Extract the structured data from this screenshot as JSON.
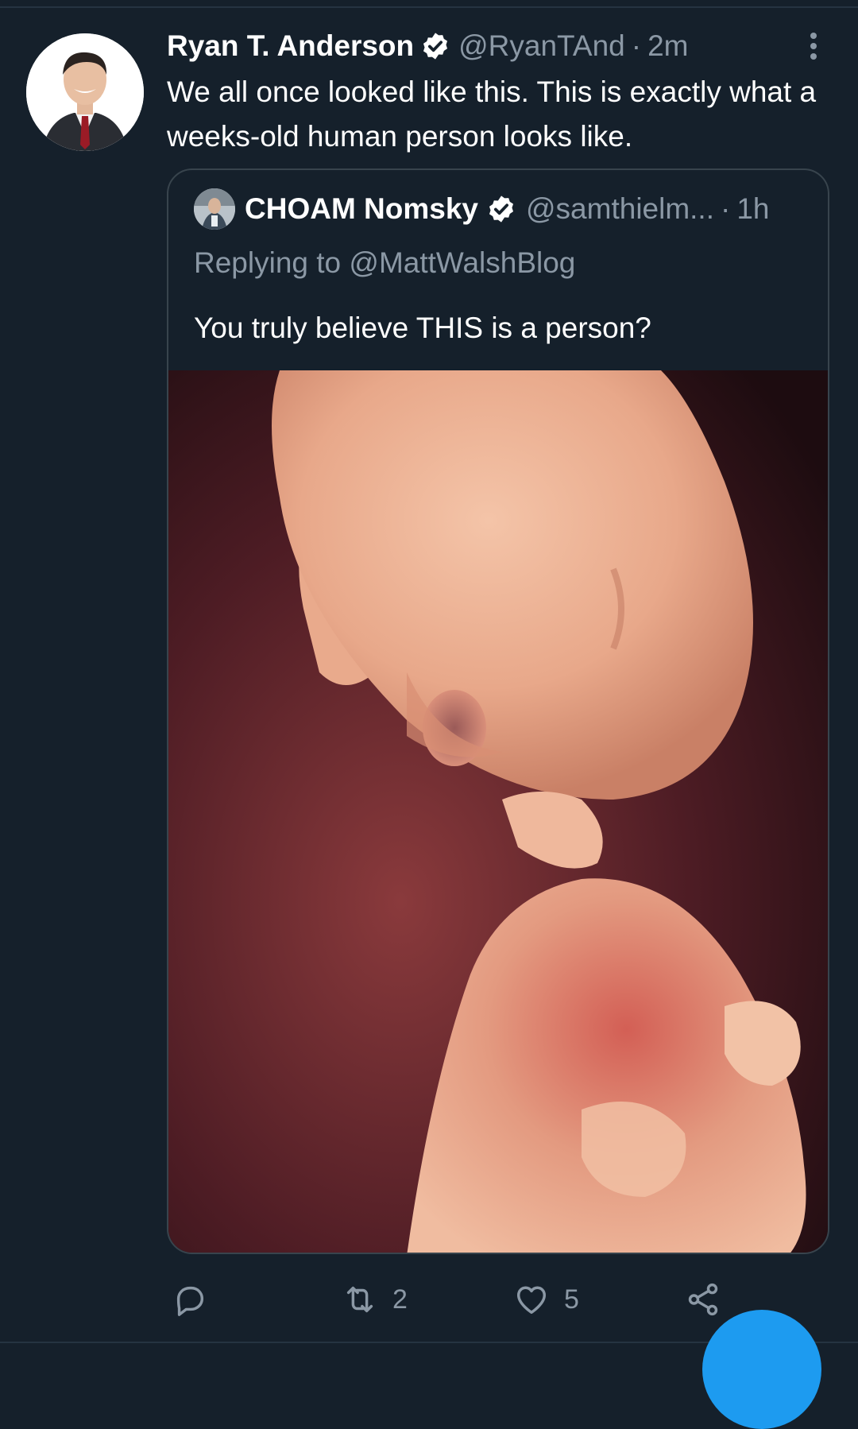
{
  "tweet": {
    "author": {
      "display_name": "Ryan T. Anderson",
      "handle": "@RyanTAnd",
      "verified": true,
      "avatar": "man-in-suit-red-tie"
    },
    "separator": "·",
    "time": "2m",
    "text": "We all once looked like this. This is exactly what a weeks-old human person looks like.",
    "more_icon": "more-vertical-icon"
  },
  "quoted_tweet": {
    "author": {
      "display_name": "CHOAM Nomsky",
      "handle": "@samthielm...",
      "verified": true
    },
    "separator": "·",
    "time": "1h",
    "replying_to": "Replying to @MattWalshBlog",
    "text": "You truly believe THIS is a person?",
    "media": "photo-embryo"
  },
  "actions": {
    "reply": {
      "icon": "reply-icon",
      "count": ""
    },
    "retweet": {
      "icon": "retweet-icon",
      "count": "2"
    },
    "like": {
      "icon": "heart-icon",
      "count": "5"
    },
    "share": {
      "icon": "share-icon"
    }
  },
  "colors": {
    "background": "#15202b",
    "text_primary": "#ffffff",
    "text_secondary": "#8b98a5",
    "border": "#38444d",
    "accent": "#1d9bf0"
  }
}
